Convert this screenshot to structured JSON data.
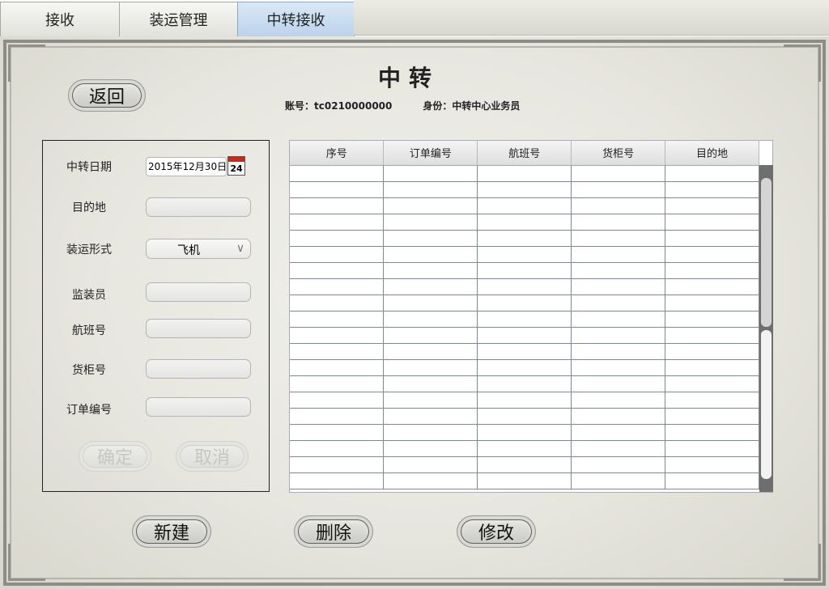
{
  "tabs": [
    {
      "label": "接收"
    },
    {
      "label": "装运管理"
    },
    {
      "label": "中转接收"
    }
  ],
  "header": {
    "title": "中转",
    "account_label": "账号：",
    "account_value": "tc0210000000",
    "identity_label": "身份：",
    "identity_value": "中转中心业务员"
  },
  "buttons": {
    "back": "返回",
    "confirm": "确定",
    "cancel": "取消",
    "new": "新建",
    "delete": "删除",
    "modify": "修改"
  },
  "form": {
    "transfer_date_label": "中转日期",
    "transfer_date_value": "2015年12月30日",
    "calendar_day": "24",
    "destination_label": "目的地",
    "destination_value": "",
    "shipping_method_label": "装运形式",
    "shipping_method_value": "飞机",
    "supervisor_label": "监装员",
    "supervisor_value": "",
    "flight_no_label": "航班号",
    "flight_no_value": "",
    "container_no_label": "货柜号",
    "container_no_value": "",
    "order_no_label": "订单编号",
    "order_no_value": ""
  },
  "table": {
    "columns": [
      "序号",
      "订单编号",
      "航班号",
      "货柜号",
      "目的地"
    ],
    "rows": [
      [
        "",
        "",
        "",
        "",
        ""
      ],
      [
        "",
        "",
        "",
        "",
        ""
      ],
      [
        "",
        "",
        "",
        "",
        ""
      ],
      [
        "",
        "",
        "",
        "",
        ""
      ],
      [
        "",
        "",
        "",
        "",
        ""
      ],
      [
        "",
        "",
        "",
        "",
        ""
      ],
      [
        "",
        "",
        "",
        "",
        ""
      ],
      [
        "",
        "",
        "",
        "",
        ""
      ],
      [
        "",
        "",
        "",
        "",
        ""
      ],
      [
        "",
        "",
        "",
        "",
        ""
      ],
      [
        "",
        "",
        "",
        "",
        ""
      ],
      [
        "",
        "",
        "",
        "",
        ""
      ],
      [
        "",
        "",
        "",
        "",
        ""
      ],
      [
        "",
        "",
        "",
        "",
        ""
      ],
      [
        "",
        "",
        "",
        "",
        ""
      ],
      [
        "",
        "",
        "",
        "",
        ""
      ],
      [
        "",
        "",
        "",
        "",
        ""
      ],
      [
        "",
        "",
        "",
        "",
        ""
      ],
      [
        "",
        "",
        "",
        "",
        ""
      ],
      [
        "",
        "",
        "",
        "",
        ""
      ]
    ]
  },
  "colors": {
    "active_tab": "#c6dbef",
    "paper": "#e9e8e1",
    "frame": "#8c8e86"
  }
}
